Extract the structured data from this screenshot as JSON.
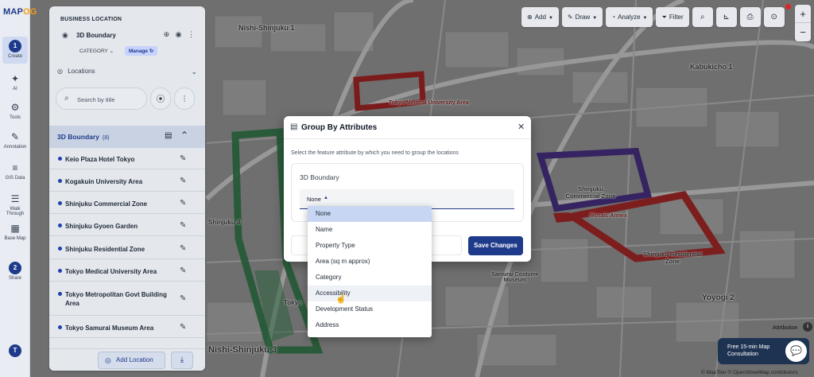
{
  "app": {
    "logo_main": "MAP",
    "logo_accent": "OG"
  },
  "rail": {
    "items": [
      {
        "label": "Create",
        "step": "1"
      },
      {
        "label": "AI"
      },
      {
        "label": "Tools"
      },
      {
        "label": "Annotation"
      },
      {
        "label": "GIS Data"
      },
      {
        "label": "Walk Through"
      },
      {
        "label": "Base Map"
      },
      {
        "label": "Share",
        "step": "2"
      }
    ],
    "avatar": "T"
  },
  "panel": {
    "section_title": "BUSINESS LOCATION",
    "layer_name": "3D Boundary",
    "category_label": "CATEGORY",
    "manage_label": "Manage",
    "locations_label": "Locations",
    "search_placeholder": "Search by title",
    "list_title": "3D Boundary",
    "list_count": "(8)",
    "locations": [
      "Keio Plaza Hotel Tokyo",
      "Kogakuin University Area",
      "Shinjuku Commercial Zone",
      "Shinjuku Gyoen Garden",
      "Shinjuku Residential Zone",
      "Tokyo Medical University Area",
      "Tokyo Metropolitan Govt Building Area",
      "Tokyo Samurai Museum Area"
    ],
    "add_location_label": "Add Location"
  },
  "toolbar": {
    "add": "Add",
    "draw": "Draw",
    "analyze": "Analyze",
    "filter": "Filter"
  },
  "modal": {
    "title": "Group By Attributes",
    "description": "Select the feature attribute by which you need to group the locations",
    "attribute_box_title": "3D Boundary",
    "selected_value": "None",
    "save_label": "Save Changes",
    "options": [
      "None",
      "Name",
      "Property Type",
      "Area (sq m approx)",
      "Category",
      "Accessibility",
      "Development Status",
      "Address"
    ]
  },
  "map": {
    "labels": {
      "tokyo_medical": "Tokyo Medical University Area",
      "shinjuku_commercial": "Shinjuku Commercial Zone",
      "shinjuku_residential": "Shinjuku Residential Zone",
      "kabukicho": "Kabukicho 1",
      "nishi_shinjuku_3": "Nishi-Shinjuku 3",
      "yoyogi_2": "Yoyogi 2",
      "samurai": "Samurai Costume Museum",
      "tokyo": "Tokyo",
      "shinjuku_4": "Shinjuku 4",
      "nishi_shinjuku_1": "Nishi-Shinjuku 1",
      "mosaic": "Mosaic Annex"
    }
  },
  "footer": {
    "consult_line1": "Free 15-min Map",
    "consult_line2": "Consultation",
    "attribution": "Attribution",
    "credits": "© MapTiler © OpenStreetMap contributors"
  },
  "colors": {
    "brand": "#1e3a8a",
    "boundary_red": "#b91c1c",
    "boundary_green": "#15803d",
    "boundary_purple": "#4c1d95"
  }
}
